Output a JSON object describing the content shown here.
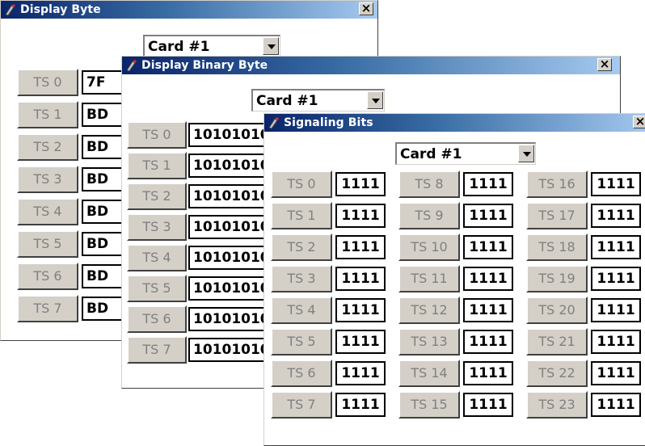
{
  "win1": {
    "title": "Display Byte",
    "card": "Card #1",
    "rows": [
      {
        "ts": "TS 0",
        "value": "7F"
      },
      {
        "ts": "TS 1",
        "value": "BD"
      },
      {
        "ts": "TS 2",
        "value": "BD"
      },
      {
        "ts": "TS 3",
        "value": "BD"
      },
      {
        "ts": "TS 4",
        "value": "BD"
      },
      {
        "ts": "TS 5",
        "value": "BD"
      },
      {
        "ts": "TS 6",
        "value": "BD"
      },
      {
        "ts": "TS 7",
        "value": "BD"
      }
    ]
  },
  "win2": {
    "title": "Display Binary Byte",
    "card": "Card #1",
    "rows": [
      {
        "ts": "TS 0",
        "value": "10101010"
      },
      {
        "ts": "TS 1",
        "value": "10101010"
      },
      {
        "ts": "TS 2",
        "value": "10101010"
      },
      {
        "ts": "TS 3",
        "value": "10101010"
      },
      {
        "ts": "TS 4",
        "value": "10101010"
      },
      {
        "ts": "TS 5",
        "value": "10101010"
      },
      {
        "ts": "TS 6",
        "value": "10101010"
      },
      {
        "ts": "TS 7",
        "value": "10101010"
      }
    ]
  },
  "win3": {
    "title": "Signaling Bits",
    "card": "Card #1",
    "columns": [
      [
        {
          "ts": "TS 0",
          "value": "1111"
        },
        {
          "ts": "TS 1",
          "value": "1111"
        },
        {
          "ts": "TS 2",
          "value": "1111"
        },
        {
          "ts": "TS 3",
          "value": "1111"
        },
        {
          "ts": "TS 4",
          "value": "1111"
        },
        {
          "ts": "TS 5",
          "value": "1111"
        },
        {
          "ts": "TS 6",
          "value": "1111"
        },
        {
          "ts": "TS 7",
          "value": "1111"
        }
      ],
      [
        {
          "ts": "TS 8",
          "value": "1111"
        },
        {
          "ts": "TS 9",
          "value": "1111"
        },
        {
          "ts": "TS 10",
          "value": "1111"
        },
        {
          "ts": "TS 11",
          "value": "1111"
        },
        {
          "ts": "TS 12",
          "value": "1111"
        },
        {
          "ts": "TS 13",
          "value": "1111"
        },
        {
          "ts": "TS 14",
          "value": "1111"
        },
        {
          "ts": "TS 15",
          "value": "1111"
        }
      ],
      [
        {
          "ts": "TS 16",
          "value": "1111"
        },
        {
          "ts": "TS 17",
          "value": "1111"
        },
        {
          "ts": "TS 18",
          "value": "1111"
        },
        {
          "ts": "TS 19",
          "value": "1111"
        },
        {
          "ts": "TS 20",
          "value": "1111"
        },
        {
          "ts": "TS 21",
          "value": "1111"
        },
        {
          "ts": "TS 22",
          "value": "1111"
        },
        {
          "ts": "TS 23",
          "value": "1111"
        }
      ]
    ]
  },
  "icons": {
    "title": "app-icon",
    "close": "close-icon",
    "dropdown": "chevron-down-icon"
  },
  "colors": {
    "titlebar_start": "#0a246a",
    "titlebar_end": "#a6caf0",
    "button_face": "#d4d0c8",
    "disabled_text": "#808080"
  }
}
